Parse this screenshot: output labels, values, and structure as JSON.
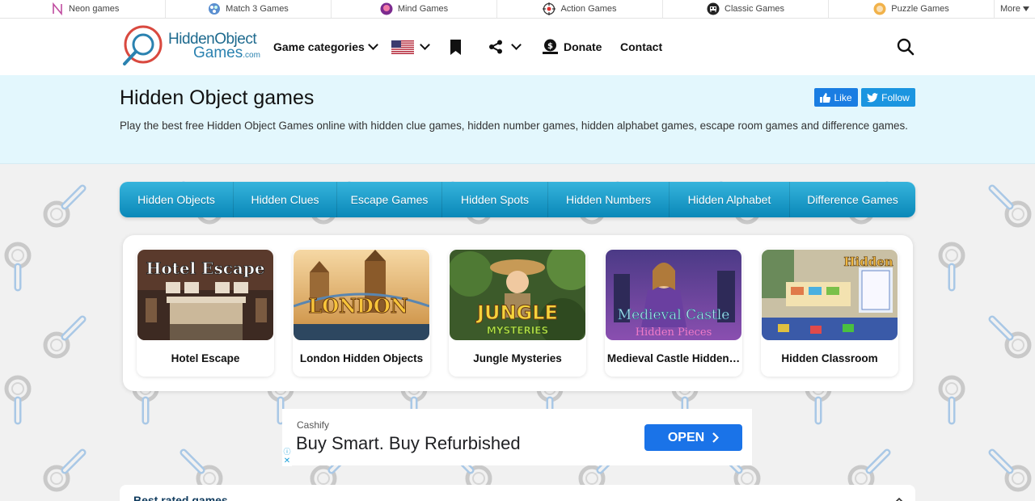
{
  "network": {
    "items": [
      {
        "label": "Neon games",
        "icon": "neon-icon"
      },
      {
        "label": "Match 3 Games",
        "icon": "match3-icon"
      },
      {
        "label": "Mind Games",
        "icon": "brain-icon"
      },
      {
        "label": "Action Games",
        "icon": "crosshair-icon"
      },
      {
        "label": "Classic Games",
        "icon": "invader-icon"
      },
      {
        "label": "Puzzle Games",
        "icon": "puzzle-icon"
      }
    ],
    "more_label": "More"
  },
  "header": {
    "logo_line1": "HiddenObject",
    "logo_line2": "Games",
    "logo_suffix": ".com",
    "categories_label": "Game categories",
    "donate_label": "Donate",
    "contact_label": "Contact"
  },
  "hero": {
    "title": "Hidden Object games",
    "description": "Play the best free Hidden Object Games online with hidden clue games, hidden number games, hidden alphabet games, escape room games and difference games.",
    "like_label": "Like",
    "follow_label": "Follow"
  },
  "categories": [
    "Hidden Objects",
    "Hidden Clues",
    "Escape Games",
    "Hidden Spots",
    "Hidden Numbers",
    "Hidden Alphabet",
    "Difference Games"
  ],
  "featured_games": [
    {
      "title": "Hotel Escape",
      "art_text": "Hotel Escape"
    },
    {
      "title": "London Hidden Objects",
      "art_text": "LONDON"
    },
    {
      "title": "Jungle Mysteries",
      "art_text": "JUNGLE",
      "art_sub": "MYSTERIES"
    },
    {
      "title": "Medieval Castle Hidden…",
      "art_text": "Medieval Castle",
      "art_sub": "Hidden Pieces"
    },
    {
      "title": "Hidden Classroom",
      "art_text": "Hidden"
    }
  ],
  "ad": {
    "brand": "Cashify",
    "headline": "Buy Smart. Buy Refurbished",
    "cta": "OPEN"
  },
  "best_rated": {
    "title": "Best rated games"
  },
  "colors": {
    "accent": "#1a8fc1",
    "hero_bg": "#e3f7fd",
    "ad_button": "#1a73e8",
    "facebook": "#1a7de2",
    "twitter": "#1b95e0"
  }
}
